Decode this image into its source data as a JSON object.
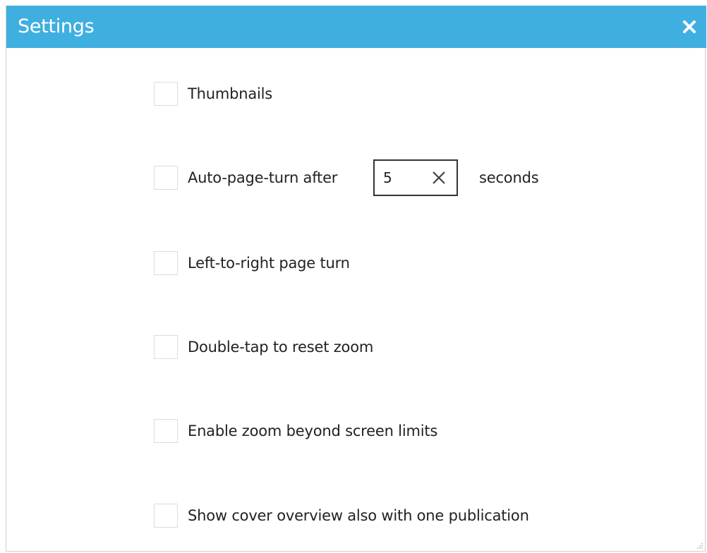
{
  "window": {
    "title": "Settings",
    "close_icon": "close-icon"
  },
  "options": [
    {
      "label": "Thumbnails",
      "checked": false
    },
    {
      "label": "Auto-page-turn after",
      "checked": false
    },
    {
      "label": "Left-to-right page turn",
      "checked": false
    },
    {
      "label": "Double-tap to reset zoom",
      "checked": false
    },
    {
      "label": "Enable zoom beyond screen limits",
      "checked": false
    },
    {
      "label": "Show cover overview also with one publication",
      "checked": false
    }
  ],
  "auto_page_turn": {
    "value": "5",
    "unit": "seconds",
    "clear_icon": "clear-icon"
  },
  "colors": {
    "titlebar": "#3fafe0",
    "title_text": "#ffffff",
    "label_text": "#222222",
    "checkbox_border": "#dcdcdc"
  }
}
